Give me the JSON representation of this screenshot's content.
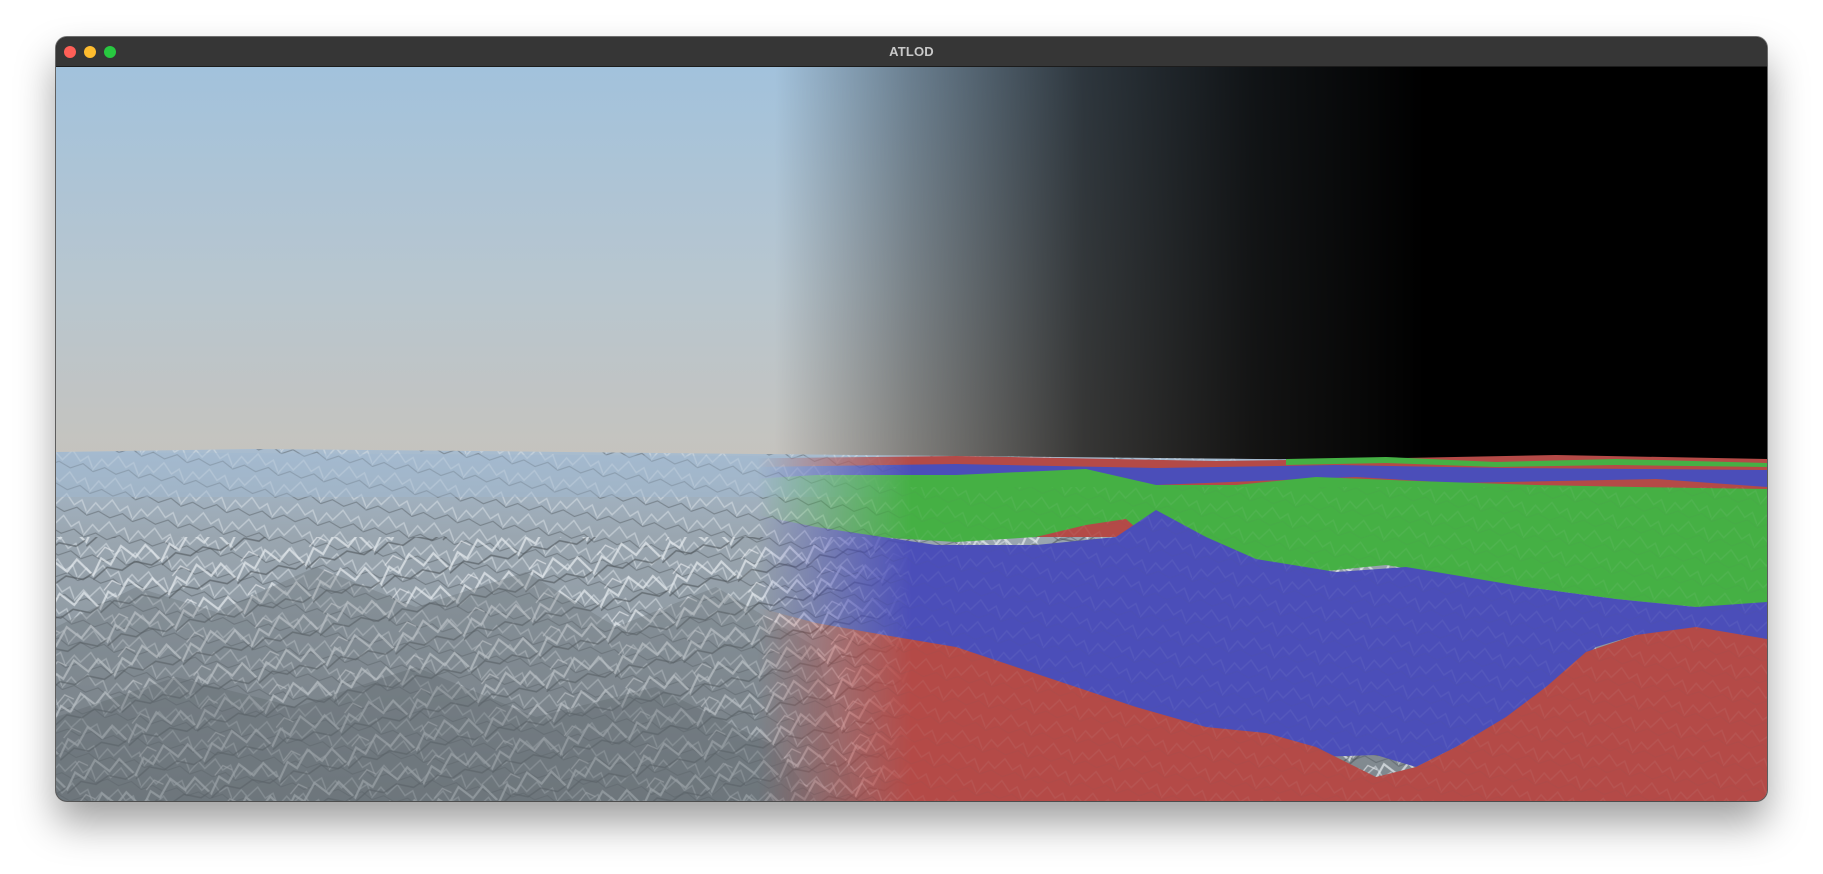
{
  "window": {
    "title": "ATLOD",
    "buttons": {
      "close_color": "#fe5f57",
      "minimize_color": "#febc2e",
      "maximize_color": "#28c840"
    }
  },
  "scene": {
    "description_colors": {
      "sky_top": "#a3c2da",
      "sky_horizon": "#c2c2c1",
      "terrain_snow": "#b9c2c9",
      "terrain_shadow": "#5b6268",
      "lod_red": "#b44a47",
      "lod_green": "#45b044",
      "lod_blue": "#4b4eb9",
      "void": "#000000"
    }
  }
}
